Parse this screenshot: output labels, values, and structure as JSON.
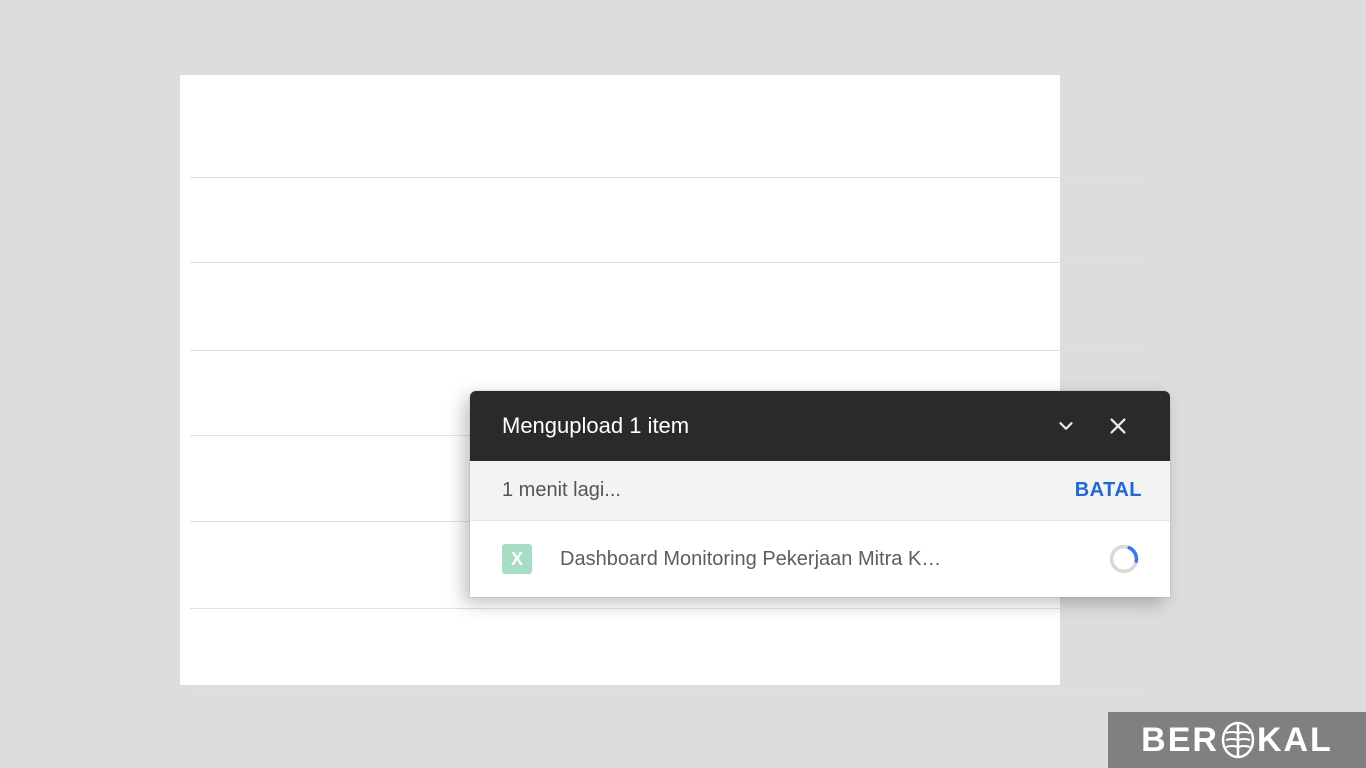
{
  "rows": [
    102,
    187,
    275,
    360,
    446,
    533,
    620
  ],
  "upload": {
    "title": "Mengupload 1 item",
    "status": "1 menit lagi...",
    "cancel": "BATAL",
    "item": {
      "icon_letter": "X",
      "name": "Dashboard Monitoring Pekerjaan Mitra K…"
    }
  },
  "watermark": {
    "pre": "BER",
    "post": "KAL"
  }
}
